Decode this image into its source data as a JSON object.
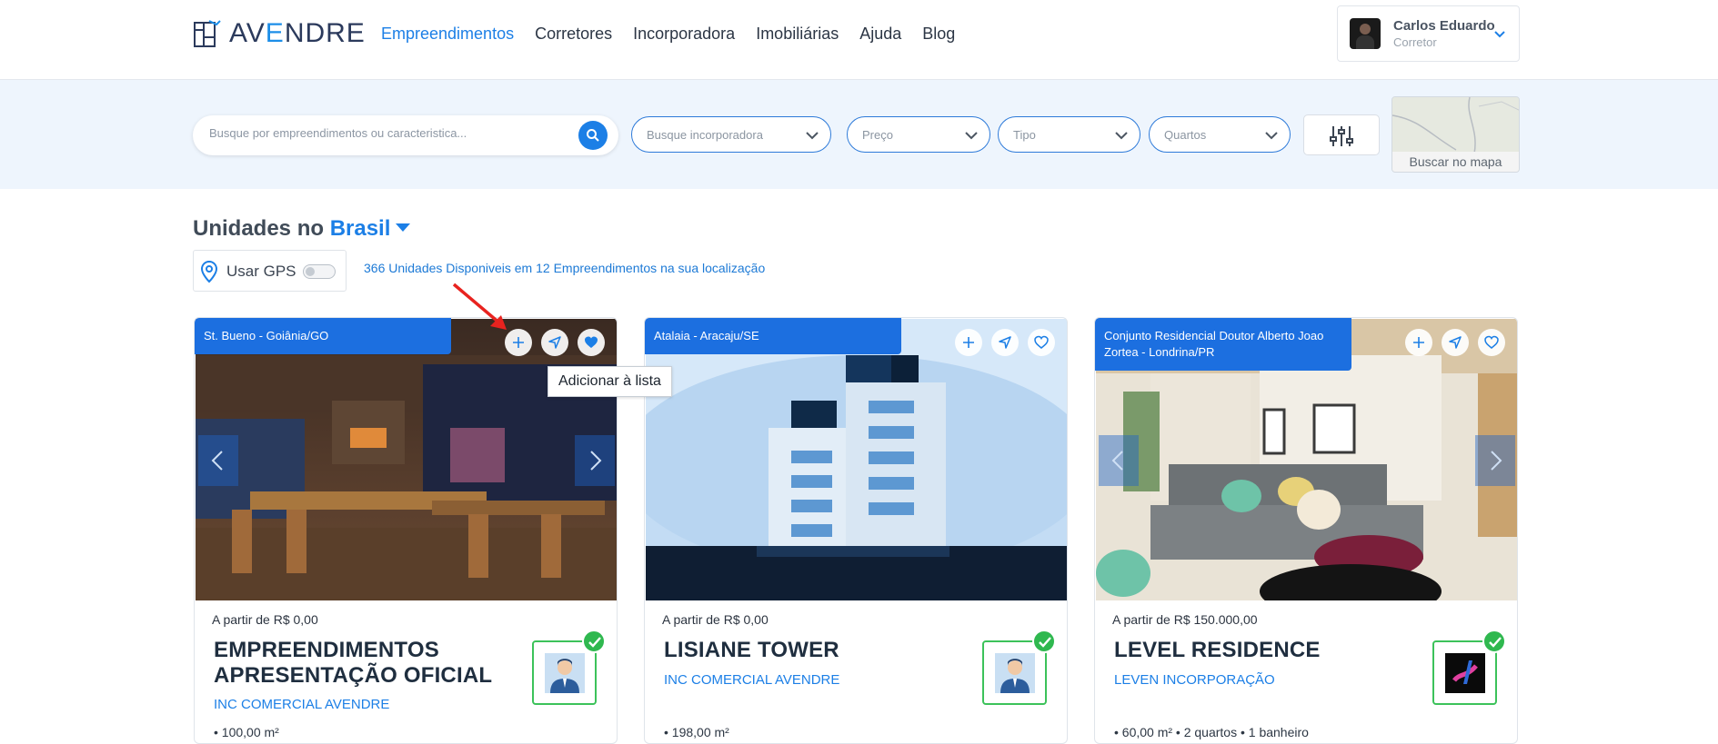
{
  "brand": {
    "name_pre": "AV",
    "name_e": "E",
    "name_post": "NDRE"
  },
  "nav": [
    {
      "label": "Empreendimentos",
      "active": true
    },
    {
      "label": "Corretores"
    },
    {
      "label": "Incorporadora"
    },
    {
      "label": "Imobiliárias"
    },
    {
      "label": "Ajuda"
    },
    {
      "label": "Blog"
    }
  ],
  "user": {
    "name": "Carlos Eduardo",
    "role": "Corretor"
  },
  "search": {
    "placeholder": "Busque por empreendimentos ou caracteristica..."
  },
  "filters": {
    "incorporadora": "Busque incorporadora",
    "preco": "Preço",
    "tipo": "Tipo",
    "quartos": "Quartos"
  },
  "map_button": "Buscar no mapa",
  "section": {
    "title_prefix": "Unidades no",
    "location": "Brasil"
  },
  "gps": {
    "label": "Usar GPS"
  },
  "count_text": "366 Unidades Disponiveis em 12 Empreendimentos na sua localização",
  "tooltip": "Adicionar à lista",
  "cards": [
    {
      "location": "St. Bueno - Goiânia/GO",
      "price": "A partir de R$ 0,00",
      "title": "EMPREENDIMENTOS APRESENTAÇÃO OFICIAL",
      "company": "INC COMERCIAL AVENDRE",
      "features": "• 100,00 m²"
    },
    {
      "location": "Atalaia - Aracaju/SE",
      "price": "A partir de R$ 0,00",
      "title": "LISIANE TOWER",
      "company": "INC COMERCIAL AVENDRE",
      "features": "• 198,00 m²"
    },
    {
      "location": "Conjunto Residencial Doutor Alberto Joao Zortea - Londrina/PR",
      "price": "A partir de R$ 150.000,00",
      "title": "LEVEL RESIDENCE",
      "company": "LEVEN INCORPORAÇÃO",
      "features": "• 60,00 m²   • 2 quartos   • 1 banheiro"
    }
  ],
  "colors": {
    "accent": "#1c7fe6",
    "verified": "#2fb84f",
    "band": "#eef5fd"
  }
}
